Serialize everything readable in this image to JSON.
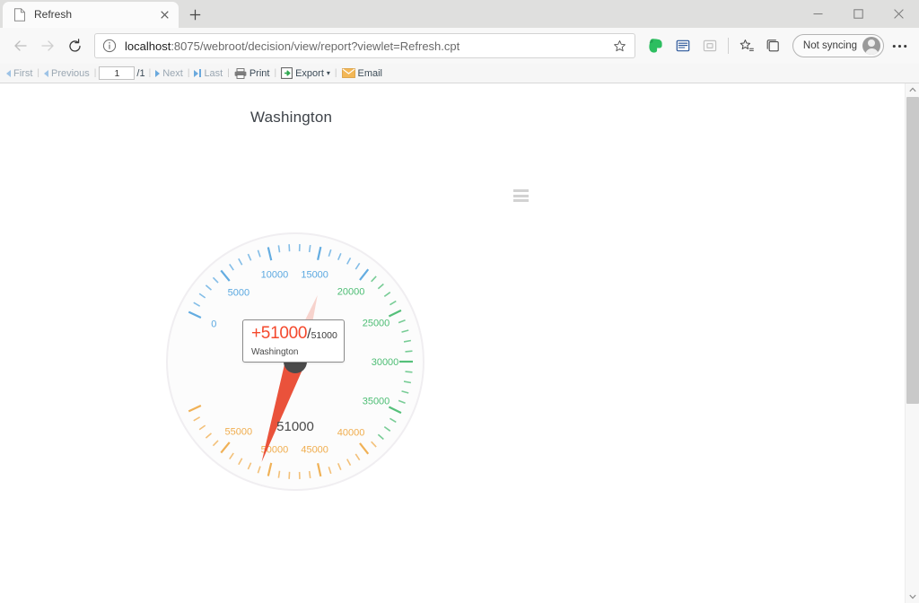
{
  "browser": {
    "tab": {
      "title": "Refresh",
      "favicon_icon": "page-icon",
      "close_icon": "close-icon"
    },
    "newtab_icon": "plus-icon",
    "window_controls": {
      "minimize": "minimize-icon",
      "maximize": "maximize-icon",
      "close": "close-icon"
    },
    "nav": {
      "back_icon": "arrow-left-icon",
      "forward_icon": "arrow-right-icon",
      "reload_icon": "reload-icon"
    },
    "omnibox": {
      "info_icon": "info-circle-icon",
      "url_host": "localhost",
      "url_rest": ":8075/webroot/decision/view/report?viewlet=Refresh.cpt",
      "url_full": "localhost:8075/webroot/decision/view/report?viewlet=Refresh.cpt",
      "star_icon": "star-outline-icon"
    },
    "toolbar_icons": [
      {
        "name": "evernote-extension-icon",
        "color": "#2dbe60"
      },
      {
        "name": "reading-view-icon",
        "color": "#2b579a"
      },
      {
        "name": "immersive-reader-icon",
        "color": "#bdbdbd"
      },
      {
        "name": "favorites-icon",
        "color": "#4a4a4a"
      },
      {
        "name": "collections-icon",
        "color": "#4a4a4a"
      }
    ],
    "profile": {
      "label": "Not syncing",
      "avatar_icon": "avatar-icon"
    },
    "settings_icon": "ellipsis-icon"
  },
  "report_toolbar": {
    "first": "First",
    "previous": "Previous",
    "page_value": "1",
    "page_total": "/1",
    "next": "Next",
    "last": "Last",
    "print": "Print",
    "export": "Export",
    "export_caret": "▾",
    "email": "Email",
    "separator": "|",
    "icons": {
      "first": "double-arrow-left-icon",
      "previous": "arrow-left-icon",
      "next": "arrow-right-icon",
      "last": "double-arrow-right-icon",
      "print": "printer-icon",
      "export": "export-icon",
      "email": "envelope-icon"
    }
  },
  "chart": {
    "title": "Washington",
    "menu_icon": "hamburger-menu-icon",
    "center_label": "51000",
    "tooltip": {
      "value": "+51000",
      "slash": "/",
      "total": "51000",
      "label": "Washington"
    },
    "colors": {
      "low": "#5ba8e0",
      "mid": "#4dbd74",
      "high": "#f0ad4e",
      "needle": "#e8432a",
      "hub": "#4a4a4a"
    }
  },
  "chart_data": {
    "type": "gauge",
    "title": "Washington",
    "value": 51000,
    "max": 51000,
    "display_value": "+51000",
    "center_label": "51000",
    "series_name": "Washington",
    "axis_min": 0,
    "axis_max": 60000,
    "tick_interval": 5000,
    "minor_tick_interval": 1000,
    "tick_labels": [
      "0",
      "5000",
      "10000",
      "15000",
      "20000",
      "25000",
      "30000",
      "35000",
      "40000",
      "45000",
      "50000",
      "55000"
    ],
    "tick_values": [
      0,
      5000,
      10000,
      15000,
      20000,
      25000,
      30000,
      35000,
      40000,
      45000,
      50000,
      55000
    ],
    "tick_label_colors": [
      "#5ba8e0",
      "#5ba8e0",
      "#5ba8e0",
      "#5ba8e0",
      "#4dbd74",
      "#4dbd74",
      "#4dbd74",
      "#4dbd74",
      "#f0ad4e",
      "#f0ad4e",
      "#f0ad4e",
      "#f0ad4e"
    ],
    "band_colors": [
      {
        "from": 0,
        "to": 20000,
        "color": "#5ba8e0"
      },
      {
        "from": 20000,
        "to": 38000,
        "color": "#4dbd74"
      },
      {
        "from": 38000,
        "to": 60000,
        "color": "#f0ad4e"
      }
    ],
    "needle_color": "#e8432a",
    "start_angle_deg": 205,
    "end_angle_deg": 515,
    "ylabel": "",
    "xlabel": "",
    "legend": []
  },
  "scrollbar": {
    "up_icon": "chevron-up-icon",
    "down_icon": "chevron-down-icon"
  }
}
